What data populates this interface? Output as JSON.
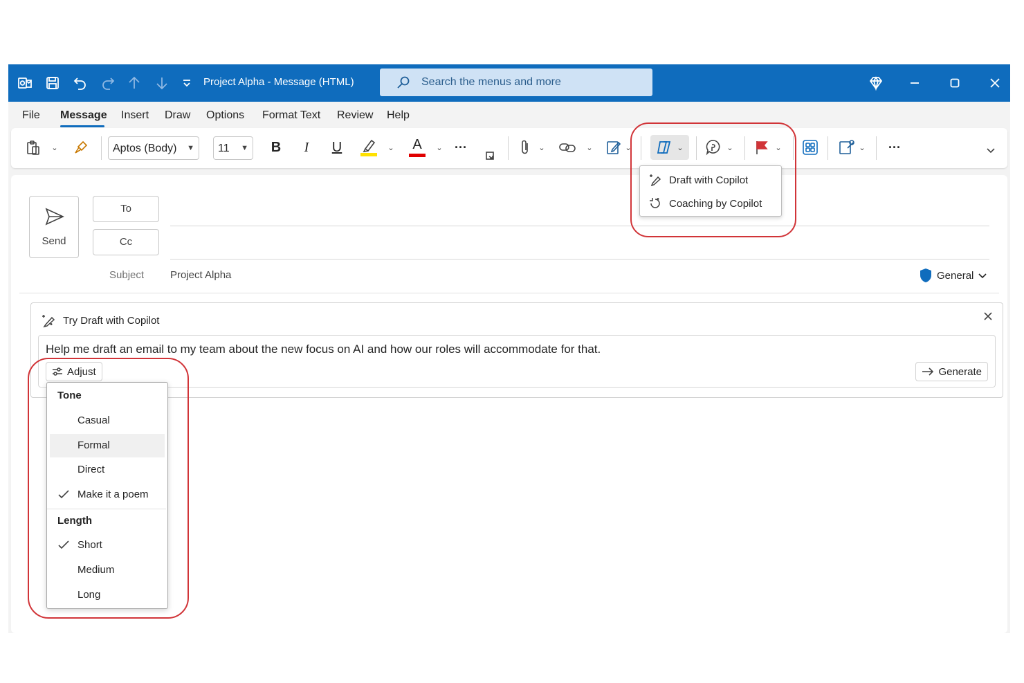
{
  "titlebar": {
    "title": "Project Alpha  -  Message (HTML)",
    "search_placeholder": "Search the menus and more"
  },
  "menu": {
    "items": [
      "File",
      "Message",
      "Insert",
      "Draw",
      "Options",
      "Format Text",
      "Review",
      "Help"
    ],
    "active": "Message"
  },
  "ribbon": {
    "font_name": "Aptos (Body)",
    "font_size": "11",
    "bold": "B",
    "italic": "I",
    "underline": "U",
    "font_color_letter": "A",
    "more": "···"
  },
  "copilot_menu": {
    "draft": "Draft with Copilot",
    "coaching": "Coaching by Copilot"
  },
  "compose": {
    "send_label": "Send",
    "to_label": "To",
    "cc_label": "Cc",
    "subject_label": "Subject",
    "subject_value": "Project Alpha",
    "sensitivity": "General"
  },
  "copilot_panel": {
    "title": "Try Draft with Copilot",
    "prompt": "Help me draft an email to my team about the new focus on AI and how our roles will accommodate for that.",
    "adjust_label": "Adjust",
    "generate_label": "Generate"
  },
  "adjust_menu": {
    "tone_header": "Tone",
    "tone_options": [
      "Casual",
      "Formal",
      "Direct",
      "Make it a poem"
    ],
    "tone_selected": "Make it a poem",
    "tone_highlighted": "Formal",
    "length_header": "Length",
    "length_options": [
      "Short",
      "Medium",
      "Long"
    ],
    "length_selected": "Short"
  },
  "colors": {
    "titlebar": "#0f6cbd",
    "annotation": "#d13438",
    "highlight_yellow": "#ffe100",
    "font_red": "#e00000",
    "flag_red": "#d13438",
    "shield_blue": "#0f6cbd"
  },
  "icons": [
    "outlook-icon",
    "save-icon",
    "undo-icon",
    "redo-icon",
    "up-arrow-icon",
    "down-arrow-icon",
    "customize-icon",
    "search-icon",
    "diamond-icon",
    "minimize-icon",
    "maximize-icon",
    "close-icon",
    "paste-icon",
    "format-painter-icon",
    "highlighter-icon",
    "attach-icon",
    "link-icon",
    "signature-icon",
    "copilot-icon",
    "chat-icon",
    "flag-icon",
    "apps-icon",
    "sensitivity-icon",
    "send-icon",
    "shield-icon",
    "sparkle-pen-icon",
    "adjust-icon",
    "arrow-right-icon",
    "check-icon"
  ]
}
